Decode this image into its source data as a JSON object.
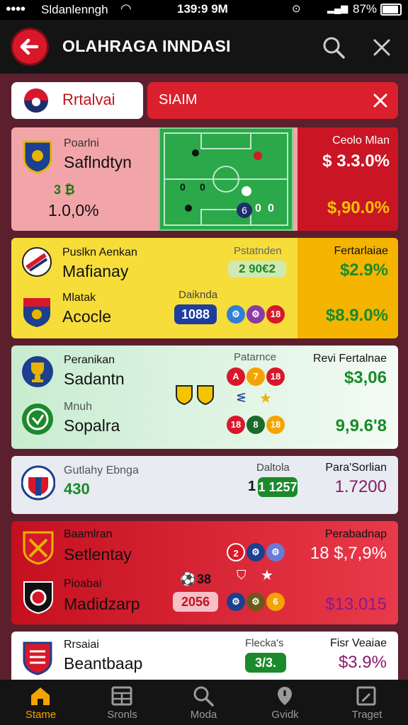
{
  "status": {
    "left": "Sldanlenngh",
    "time": "139:9 9M",
    "battery": "87%"
  },
  "header": {
    "title": "OLAHRAGA INNDASI"
  },
  "filter": {
    "chip_label": "Rrtalvai",
    "search_value": "SIAIM"
  },
  "match1": {
    "league": "Poarlni",
    "team": "Saflndtyn",
    "mini": "3 ₿",
    "value": "1.0,0%",
    "odds_title": "Ceolo Mlan",
    "odds1": "$ 3.3.0%",
    "odds2": "$,90.0%",
    "pitch_labels": [
      "0",
      "0",
      "6",
      "0",
      "0"
    ]
  },
  "match2": {
    "t1_sub": "Puslkn Aenkan",
    "t1": "Mafianay",
    "t2_sub": "Mlatak",
    "t2": "Acocle",
    "mid_title": "Pstatnden",
    "score_badge": "2 90€2",
    "stat_title": "Daiknda",
    "stat_badge": "1088",
    "dots": [
      "⚙",
      "⚙",
      "18"
    ],
    "right_title": "Fertarlaiae",
    "odds1": "$2.9%",
    "odds2": "$8.9.0%"
  },
  "match3": {
    "t1_sub": "Peranikan",
    "t1": "Sadantn",
    "t2_sub": "Mnuh",
    "t2": "Sopalra",
    "mid_title": "Patarnce",
    "dots1": [
      "A",
      "7",
      "18"
    ],
    "dots2": [
      "18",
      "8",
      "18"
    ],
    "right_title": "Revi Fertalnae",
    "odds1": "$3,06",
    "odds2": "9,9.6'8"
  },
  "match4": {
    "sub": "Gutlahy Ebnga",
    "value": "430",
    "mid_title": "Daltola",
    "badge": "1 1257",
    "right_title": "Para'Sorlian",
    "odds": "1.7200"
  },
  "match5": {
    "t1_sub": "Baamlran",
    "t1": "Setlentay",
    "t2_sub": "Pioabai",
    "t2": "Madidzarp",
    "mini": "38",
    "score_badge": "2056",
    "dots1": [
      "2",
      "⚙",
      "⚙"
    ],
    "dots2": [
      "⚙",
      "⚙",
      "6"
    ],
    "right_title": "Perabadnap",
    "odds1": "18 $,7,9%",
    "odds2": "$13.015"
  },
  "match6": {
    "sub": "Rrsaiai",
    "team": "Beantbaap",
    "mid_title": "Flecka's",
    "badge": "3/3.",
    "right_title": "Fisr Veaiae",
    "odds": "$3.9%"
  },
  "nav": {
    "items": [
      "Stame",
      "Sronls",
      "Moda",
      "Gvidk",
      "Traget"
    ]
  },
  "colors": {
    "accent": "#d9202c",
    "active_nav": "#f5a300",
    "green": "#1a8a2a"
  }
}
